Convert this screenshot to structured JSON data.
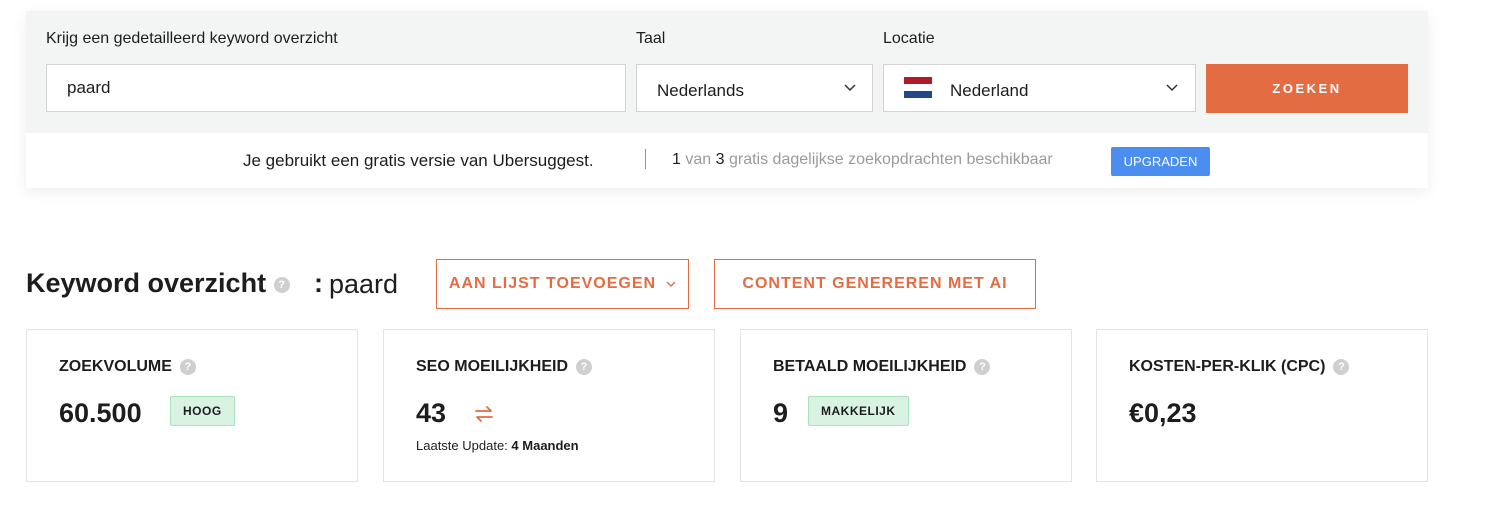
{
  "search": {
    "keyword_label": "Krijg een gedetailleerd keyword overzicht",
    "keyword_value": "paard",
    "language_label": "Taal",
    "language_value": "Nederlands",
    "location_label": "Locatie",
    "location_value": "Nederland",
    "search_button": "ZOEKEN",
    "flag_colors": [
      "#ae1c28",
      "#ffffff",
      "#21468b"
    ]
  },
  "notice": {
    "free_version_text": "Je gebruikt een gratis versie van Ubersuggest.",
    "quota_used": "1",
    "quota_of": "van",
    "quota_total": "3",
    "quota_text": "gratis dagelijkse zoekopdrachten beschikbaar",
    "upgrade_button": "UPGRADEN"
  },
  "overview": {
    "title": "Keyword overzicht",
    "help_glyph": "?",
    "colon": ":",
    "keyword": "paard",
    "add_to_list_button": "AAN LIJST TOEVOEGEN",
    "generate_content_button": "CONTENT GENEREREN MET AI"
  },
  "cards": [
    {
      "title": "ZOEKVOLUME",
      "value": "60.500",
      "badge": "HOOG"
    },
    {
      "title": "SEO MOEILIJKHEID",
      "value": "43",
      "update_label": "Laatste Update:",
      "update_value": "4 Maanden"
    },
    {
      "title": "BETAALD MOEILIJKHEID",
      "value": "9",
      "badge": "MAKKELIJK"
    },
    {
      "title": "KOSTEN-PER-KLIK (CPC)",
      "value": "€0,23"
    }
  ],
  "colors": {
    "accent": "#e46c42",
    "upgrade": "#4b8ef0",
    "badge_bg": "#d9f3e3",
    "panel_bg": "#f3f5f4"
  }
}
